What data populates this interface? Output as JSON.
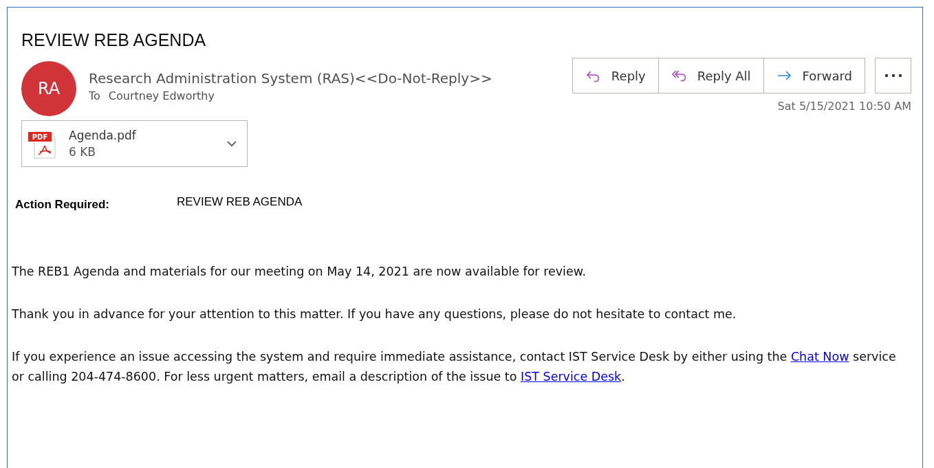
{
  "subject": "REVIEW REB AGENDA",
  "sender": {
    "initials": "RA",
    "name": "Research Administration System (RAS)<<Do-Not-Reply>>",
    "to_label": "To",
    "to": "Courtney Edworthy"
  },
  "actions": [
    {
      "kind": "reply",
      "label": "Reply"
    },
    {
      "kind": "reply_all",
      "label": "Reply All"
    },
    {
      "kind": "forward",
      "label": "Forward"
    }
  ],
  "date": "Sat 5/15/2021 10:50 AM",
  "attachment": {
    "badge": "PDF",
    "name": "Agenda.pdf",
    "size": "6 KB"
  },
  "action_required": {
    "label": "Action Required:",
    "value": "REVIEW REB AGENDA"
  },
  "paragraphs": [
    [
      {
        "kind": "text",
        "text": "The REB1 Agenda and materials for our meeting on May 14, 2021 are now available for review."
      }
    ],
    [
      {
        "kind": "text",
        "text": "Thank you in advance for your attention to this matter. If you have any questions, please do not hesitate to contact me."
      }
    ],
    [
      {
        "kind": "text",
        "text": "If you experience an issue accessing the system and require immediate assistance, contact IST Service Desk by either using the "
      },
      {
        "kind": "link",
        "text": "Chat Now"
      },
      {
        "kind": "text",
        "text": " service or calling 204-474-8600. For less urgent matters, email a description of the issue to "
      },
      {
        "kind": "link",
        "text": "IST Service Desk"
      },
      {
        "kind": "text",
        "text": "."
      }
    ]
  ]
}
